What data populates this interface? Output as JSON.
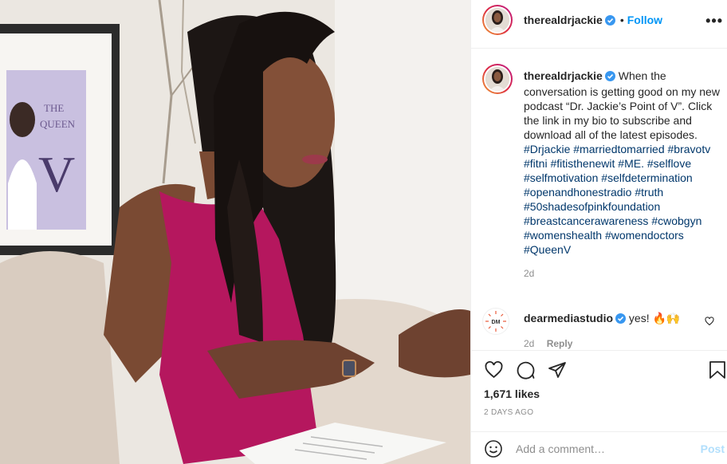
{
  "header": {
    "username": "therealdrjackie",
    "separator": "•",
    "follow_label": "Follow",
    "more_icon": "more-horizontal-icon",
    "more_label": "•••"
  },
  "caption": {
    "username": "therealdrjackie",
    "text": "When the conversation is getting good on my new podcast “Dr. Jackie’s Point of V”. Click the link in my bio to subscribe and download all of the latest episodes.",
    "hashtags": [
      "#Drjackie",
      "#marriedtomarried",
      "#bravotv",
      "#fitni",
      "#fitisthenewit",
      "#ME.",
      "#selflove",
      "#selfmotivation",
      "#selfdetermination",
      "#openandhonestradio",
      "#truth",
      "#50shadesofpinkfoundation",
      "#breastcancerawareness",
      "#cwobgyn",
      "#womenshealth",
      "#womendoctors",
      "#QueenV"
    ],
    "time": "2d"
  },
  "comment": {
    "username": "dearmediastudio",
    "text": "yes! 🔥🙌",
    "time": "2d",
    "reply_label": "Reply",
    "avatar_text": "DM"
  },
  "actions": {
    "likes": "1,671 likes",
    "date": "2 DAYS AGO"
  },
  "add_comment": {
    "placeholder": "Add a comment…",
    "post_label": "Post"
  },
  "photo": {
    "book_title_line1": "THE",
    "book_title_line2": "QUEEN",
    "book_letter": "V"
  },
  "colors": {
    "accent": "#0095f6",
    "hashtag": "#00376b",
    "verified": "#3897f0",
    "dress": "#b5175e"
  }
}
